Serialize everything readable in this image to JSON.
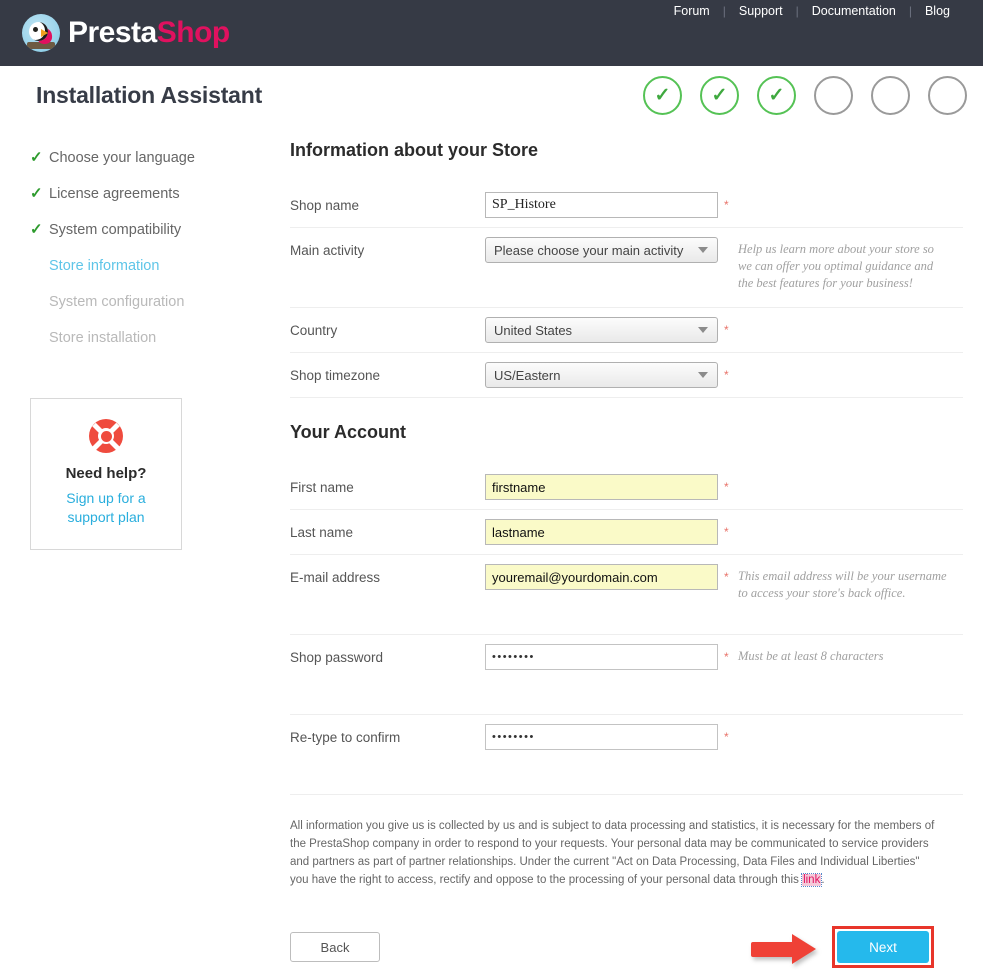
{
  "topbar": {
    "logo_text_1": "Presta",
    "logo_text_2": "Shop",
    "nav": [
      {
        "label": "Forum"
      },
      {
        "label": "Support"
      },
      {
        "label": "Documentation"
      },
      {
        "label": "Blog"
      }
    ],
    "separator": "|"
  },
  "header": {
    "title": "Installation Assistant",
    "steps": [
      {
        "state": "done",
        "glyph": "✓"
      },
      {
        "state": "done",
        "glyph": "✓"
      },
      {
        "state": "done",
        "glyph": "✓"
      },
      {
        "state": "pending",
        "glyph": ""
      },
      {
        "state": "pending",
        "glyph": ""
      },
      {
        "state": "pending",
        "glyph": ""
      }
    ]
  },
  "sidebar": {
    "items": [
      {
        "label": "Choose your language",
        "state": "done",
        "check": "✓"
      },
      {
        "label": "License agreements",
        "state": "done",
        "check": "✓"
      },
      {
        "label": "System compatibility",
        "state": "done",
        "check": "✓"
      },
      {
        "label": "Store information",
        "state": "active",
        "check": ""
      },
      {
        "label": "System configuration",
        "state": "muted",
        "check": ""
      },
      {
        "label": "Store installation",
        "state": "muted",
        "check": ""
      }
    ],
    "help": {
      "title": "Need help?",
      "link_line1": "Sign up for a",
      "link_line2": "support plan"
    }
  },
  "form": {
    "store_section_title": "Information about your Store",
    "account_section_title": "Your Account",
    "required_marker": "*",
    "shop_name": {
      "label": "Shop name",
      "value": "SP_Histore"
    },
    "main_activity": {
      "label": "Main activity",
      "value": "Please choose your main activity",
      "help": "Help us learn more about your store so we can offer you optimal guidance and the best features for your business!"
    },
    "country": {
      "label": "Country",
      "value": "United States"
    },
    "timezone": {
      "label": "Shop timezone",
      "value": "US/Eastern"
    },
    "first_name": {
      "label": "First name",
      "value": "firstname"
    },
    "last_name": {
      "label": "Last name",
      "value": "lastname"
    },
    "email": {
      "label": "E-mail address",
      "value": "youremail@yourdomain.com",
      "help": "This email address will be your username to access your store's back office."
    },
    "password": {
      "label": "Shop password",
      "value": "••••••••",
      "help": "Must be at least 8 characters"
    },
    "password_confirm": {
      "label": "Re-type to confirm",
      "value": "••••••••"
    }
  },
  "legal": {
    "text_before_link": "All information you give us is collected by us and is subject to data processing and statistics, it is necessary for the members of the PrestaShop company in order to respond to your requests. Your personal data may be communicated to service providers and partners as part of partner relationships. Under the current \"Act on Data Processing, Data Files and Individual Liberties\" you have the right to access, rectify and oppose to the processing of your personal data through this ",
    "link_text": "link",
    "text_after_link": "."
  },
  "actions": {
    "back_label": "Back",
    "next_label": "Next"
  },
  "colors": {
    "topbar_bg": "#363a45",
    "brand_pink": "#e0115f",
    "active_blue": "#5ec5e8",
    "next_blue": "#25b9ec",
    "highlight_red": "#e8352a",
    "check_green": "#2e9b2e",
    "autofill_yellow": "#fafac8"
  }
}
